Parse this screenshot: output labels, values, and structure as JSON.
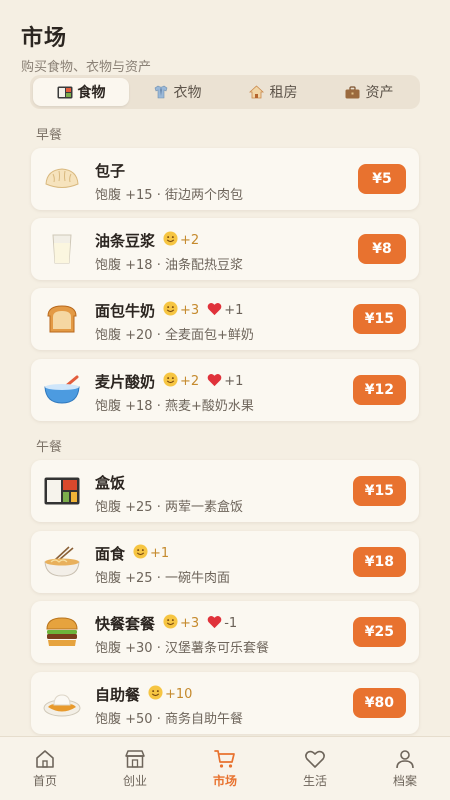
{
  "header": {
    "title": "市场",
    "subtitle": "购买食物、衣物与资产"
  },
  "tabs": [
    {
      "label": "食物",
      "icon": "bento-icon",
      "active": true
    },
    {
      "label": "衣物",
      "icon": "shirt-icon",
      "active": false
    },
    {
      "label": "租房",
      "icon": "house-icon",
      "active": false
    },
    {
      "label": "资产",
      "icon": "briefcase-icon",
      "active": false
    }
  ],
  "sections": [
    {
      "label": "早餐",
      "items": [
        {
          "name": "包子",
          "icon": "dumpling-icon",
          "desc": "饱腹 +15 · 街边两个肉包",
          "price": "¥5",
          "mood": "",
          "health": ""
        },
        {
          "name": "油条豆浆",
          "icon": "milk-glass-icon",
          "desc": "饱腹 +18 · 油条配热豆浆",
          "price": "¥8",
          "mood": "+2",
          "health": ""
        },
        {
          "name": "面包牛奶",
          "icon": "bread-icon",
          "desc": "饱腹 +20 · 全麦面包+鲜奶",
          "price": "¥15",
          "mood": "+3",
          "health": "+1"
        },
        {
          "name": "麦片酸奶",
          "icon": "bowl-icon",
          "desc": "饱腹 +18 · 燕麦+酸奶水果",
          "price": "¥12",
          "mood": "+2",
          "health": "+1"
        }
      ]
    },
    {
      "label": "午餐",
      "items": [
        {
          "name": "盒饭",
          "icon": "bento-box-icon",
          "desc": "饱腹 +25 · 两荤一素盒饭",
          "price": "¥15",
          "mood": "",
          "health": ""
        },
        {
          "name": "面食",
          "icon": "noodle-bowl-icon",
          "desc": "饱腹 +25 · 一碗牛肉面",
          "price": "¥18",
          "mood": "+1",
          "health": ""
        },
        {
          "name": "快餐套餐",
          "icon": "burger-icon",
          "desc": "饱腹 +30 · 汉堡薯条可乐套餐",
          "price": "¥25",
          "mood": "+3",
          "health": "-1"
        },
        {
          "name": "自助餐",
          "icon": "curry-plate-icon",
          "desc": "饱腹 +50 · 商务自助午餐",
          "price": "¥80",
          "mood": "+10",
          "health": ""
        }
      ]
    }
  ],
  "bottom_nav": [
    {
      "label": "首页",
      "icon": "home-icon",
      "active": false
    },
    {
      "label": "创业",
      "icon": "store-icon",
      "active": false
    },
    {
      "label": "市场",
      "icon": "cart-icon",
      "active": true
    },
    {
      "label": "生活",
      "icon": "heart-outline-icon",
      "active": false
    },
    {
      "label": "档案",
      "icon": "person-icon",
      "active": false
    }
  ],
  "colors": {
    "background": "#f5efe3",
    "accent": "#e8722f",
    "card": "#fbf8f1"
  }
}
